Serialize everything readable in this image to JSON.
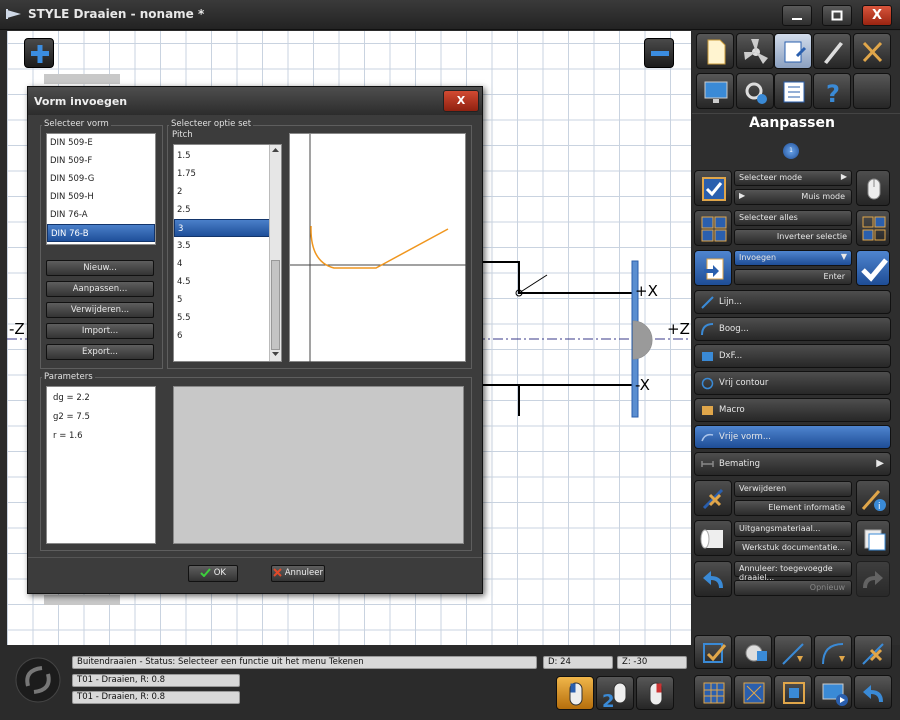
{
  "window": {
    "title": "STYLE Draaien - noname *",
    "min_label": "—",
    "max_label": "☐",
    "close_label": "X"
  },
  "canvas": {
    "axis_labels": {
      "minus_z": "-Z",
      "plus_z": "+Z",
      "plus_x": "+X",
      "minus_x": "-X"
    }
  },
  "dialog": {
    "title": "Vorm invoegen",
    "close_label": "X",
    "shape_group_label": "Selecteer vorm",
    "shapes": [
      "DIN 509-E",
      "DIN 509-F",
      "DIN 509-G",
      "DIN 509-H",
      "DIN 76-A",
      "DIN 76-B"
    ],
    "selected_shape": "DIN 76-B",
    "buttons": [
      "Nieuw...",
      "Aanpassen...",
      "Verwijderen...",
      "Import...",
      "Export..."
    ],
    "option_group_label": "Selecteer optie set",
    "pitch_label": "Pitch",
    "pitches": [
      "1.5",
      "1.75",
      "2",
      "2.5",
      "3",
      "3.5",
      "4",
      "4.5",
      "5",
      "5.5",
      "6"
    ],
    "selected_pitch": "3",
    "params_group_label": "Parameters",
    "params": [
      "dg = 2.2",
      "g2 = 7.5",
      "r = 1.6"
    ],
    "ok_label": "OK",
    "cancel_label": "Annuleer"
  },
  "panel": {
    "heading": "Aanpassen",
    "page_indicator": "1",
    "select_mode": "Selecteer mode",
    "mouse_mode": "Muis mode",
    "select_all": "Selecteer alles",
    "invert_selection": "Inverteer selectie",
    "insert": "Invoegen",
    "enter": "Enter",
    "items": [
      "Lijn...",
      "Boog...",
      "DxF...",
      "Vrij contour",
      "Macro",
      "Vrije vorm...",
      "Bemating"
    ],
    "active_item": "Vrije vorm...",
    "delete": "Verwijderen",
    "element_info": "Element informatie",
    "stock_material": "Uitgangsmateriaal...",
    "workpiece_doc": "Werkstuk documentatie...",
    "undo": "Annuleer: toegevoegde draaiel...",
    "redo": "Opnieuw"
  },
  "status": {
    "message": "Buitendraaien - Status: Selecteer een functie uit het menu Tekenen",
    "d_value": "D: 24",
    "z_value": "Z: -30",
    "tool1": "T01 - Draaien, R: 0.8",
    "tool2": "T01 - Draaien, R: 0.8"
  },
  "colors": {
    "accent_blue": "#2a5fae",
    "contour_orange": "#f0961e",
    "close_red": "#c43a22"
  }
}
